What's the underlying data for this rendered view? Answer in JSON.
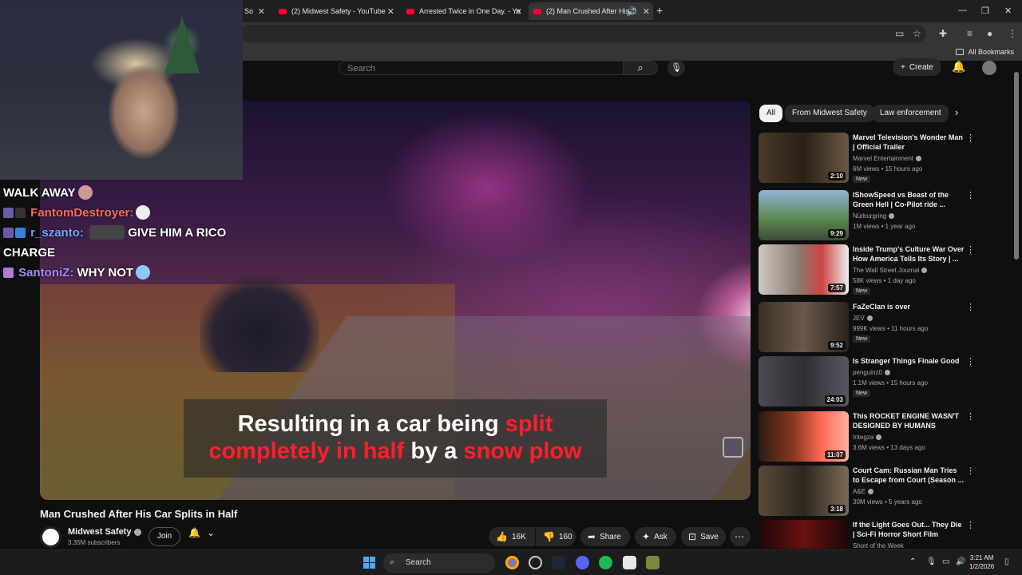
{
  "browser": {
    "tabs": [
      {
        "title": "So",
        "active": false
      },
      {
        "title": "(2) Midwest Safety - YouTube",
        "active": false
      },
      {
        "title": "Arrested Twice in One Day. - Yo",
        "active": false
      },
      {
        "title": "(2) Man Crushed After His C",
        "active": true
      }
    ],
    "bookmarks_label": "All Bookmarks"
  },
  "masthead": {
    "search_placeholder": "Search",
    "create_label": "Create"
  },
  "player": {
    "caption_line1": [
      {
        "text": "Resulting in a car being ",
        "color": "white"
      },
      {
        "text": "split",
        "color": "red"
      }
    ],
    "caption_line2": [
      {
        "text": "completely in half",
        "color": "red"
      },
      {
        "text": " by a ",
        "color": "white"
      },
      {
        "text": "snow plow",
        "color": "red"
      }
    ]
  },
  "video": {
    "title": "Man Crushed After His Car Splits in Half",
    "channel": "Midwest Safety",
    "subscribers": "3.35M subscribers",
    "join_label": "Join",
    "likes": "16K",
    "dislikes": "160",
    "share_label": "Share",
    "ask_label": "Ask",
    "save_label": "Save"
  },
  "chips": [
    "All",
    "From Midwest Safety",
    "Law enforcement"
  ],
  "recommendations": [
    {
      "title": "Marvel Television's Wonder Man | Official Trailer",
      "channel": "Marvel Entertainment",
      "meta": "6M views • 15 hours ago",
      "duration": "2:10",
      "new": true
    },
    {
      "title": "IShowSpeed vs Beast of the Green Hell | Co-Pilot ride ...",
      "channel": "Nürburgring",
      "meta": "1M views • 1 year ago",
      "duration": "9:29",
      "new": false
    },
    {
      "title": "Inside Trump's Culture War Over How America Tells Its Story | ...",
      "channel": "The Wall Street Journal",
      "meta": "58K views • 1 day ago",
      "duration": "7:57",
      "new": true
    },
    {
      "title": "FaZeClan is over",
      "channel": "JEV",
      "meta": "999K views • 11 hours ago",
      "duration": "9:52",
      "new": true
    },
    {
      "title": "Is Stranger Things Finale Good",
      "channel": "penguinz0",
      "meta": "1.1M views • 15 hours ago",
      "duration": "24:03",
      "new": true
    },
    {
      "title": "This ROCKET ENGINE WASN'T DESIGNED BY HUMANS",
      "channel": "Integza",
      "meta": "3.6M views • 13 days ago",
      "duration": "11:07",
      "new": false
    },
    {
      "title": "Court Cam: Russian Man Tries to Escape from Court (Season ...",
      "channel": "A&E",
      "meta": "30M views • 5 years ago",
      "duration": "3:18",
      "new": false
    },
    {
      "title": "If the Light Goes Out... They Die | Sci-Fi Horror Short Film",
      "channel": "Short of the Week",
      "meta": "",
      "duration": "",
      "new": false
    }
  ],
  "new_badge": "New",
  "chat": {
    "line1": "WALK AWAY",
    "user1": "FantomDestroyer:",
    "user2": "r_szanto:",
    "msg2": "GIVE HIM A RICO CHARGE",
    "user3": "SantoniZ:",
    "msg3": "WHY NOT"
  },
  "taskbar": {
    "search_label": "Search",
    "time": "3:21 AM",
    "date": "1/2/2026"
  },
  "colors": {
    "youtube_red": "#ff0033",
    "caption_red": "#ff1e2d",
    "background": "#0f0f0f"
  }
}
